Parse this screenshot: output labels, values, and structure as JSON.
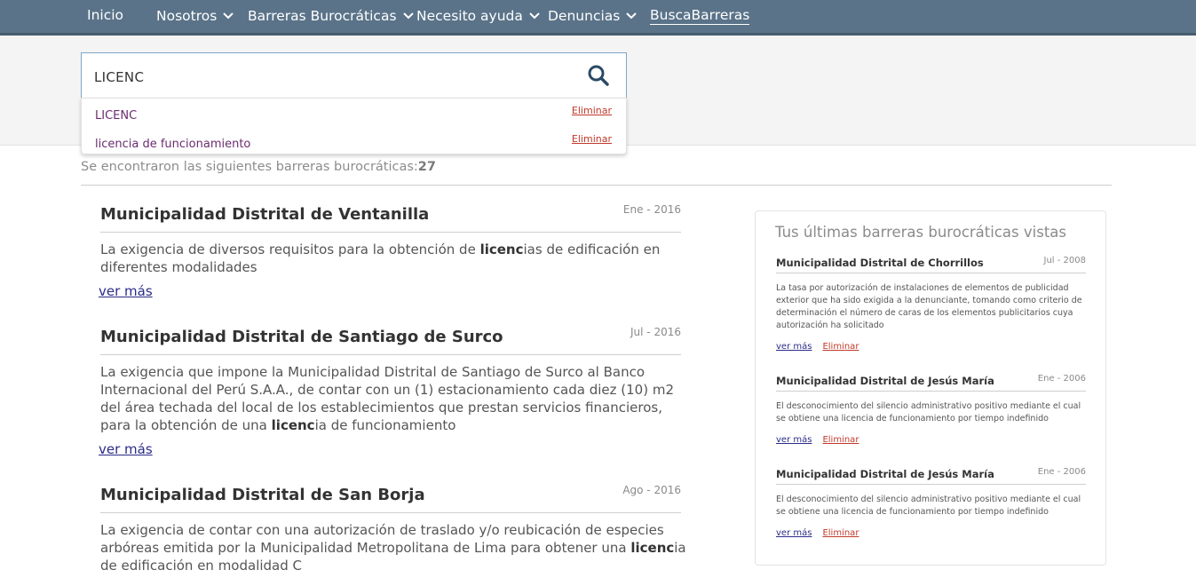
{
  "nav": {
    "items": [
      {
        "label": "Inicio",
        "has_menu": false
      },
      {
        "label": "Nosotros",
        "has_menu": true
      },
      {
        "label": "Barreras Burocráticas",
        "has_menu": true
      },
      {
        "label": "Necesito ayuda",
        "has_menu": true
      },
      {
        "label": "Denuncias",
        "has_menu": true
      },
      {
        "label": "BuscaBarreras",
        "has_menu": false,
        "active": true
      }
    ]
  },
  "search": {
    "value": "LICENC",
    "icon": "search-icon",
    "suggestions": [
      {
        "text": "LICENC",
        "remove_label": "Eliminar"
      },
      {
        "text": "licencia de funcionamiento",
        "remove_label": "Eliminar"
      }
    ]
  },
  "results_summary": {
    "text": "Se encontraron las siguientes barreras burocráticas:",
    "count": "27"
  },
  "results": [
    {
      "title": "Municipalidad Distrital de Ventanilla",
      "date": "Ene - 2016",
      "desc_before": "La exigencia de diversos requisitos para la obtención de ",
      "desc_match": "licenc",
      "desc_after": "ias de edificación en diferentes modalidades",
      "more_label": "ver más"
    },
    {
      "title": "Municipalidad Distrital de Santiago de Surco",
      "date": "Jul - 2016",
      "desc_before": "La exigencia que impone la Municipalidad Distrital de Santiago de Surco al Banco Internacional del Perú S.A.A., de contar con un (1) estacionamiento cada diez (10) m2 del área techada del local de los establecimientos que prestan servicios financieros, para la obtención de una ",
      "desc_match": "licenc",
      "desc_after": "ia de funcionamiento",
      "more_label": "ver más"
    },
    {
      "title": "Municipalidad Distrital de San Borja",
      "date": "Ago - 2016",
      "desc_before": "La exigencia de contar con una autorización de traslado y/o reubicación de especies arbóreas emitida por la Municipalidad Metropolitana de Lima para obtener una ",
      "desc_match": "licenc",
      "desc_after": "ia de edificación en modalidad C",
      "more_label": ""
    }
  ],
  "sidebar": {
    "title": "Tus últimas barreras burocráticas vistas",
    "items": [
      {
        "title": "Municipalidad Distrital de Chorrillos",
        "date": "Jul - 2008",
        "desc": "La tasa por autorización de instalaciones de elementos de publicidad exterior que ha sido exigida a la denunciante, tomando como criterio de determinación el número de caras de los elementos publicitarios cuya autorización ha solicitado",
        "more_label": "ver más",
        "remove_label": "Eliminar"
      },
      {
        "title": "Municipalidad Distrital de Jesús María",
        "date": "Ene - 2006",
        "desc": "El desconocimiento del silencio administrativo positivo mediante el cual se obtiene una licencia de funcionamiento por tiempo indefinido",
        "more_label": "ver más",
        "remove_label": "Eliminar"
      },
      {
        "title": "Municipalidad Distrital de Jesús María",
        "date": "Ene - 2006",
        "desc": "El desconocimiento del silencio administrativo positivo mediante el cual se obtiene una licencia de funcionamiento por tiempo indefinido",
        "more_label": "ver más",
        "remove_label": "Eliminar"
      }
    ]
  },
  "colors": {
    "nav_bg": "#5a7389",
    "link": "#2b2b8a",
    "remove": "#c0392b",
    "suggestion": "#6a2c6f"
  }
}
